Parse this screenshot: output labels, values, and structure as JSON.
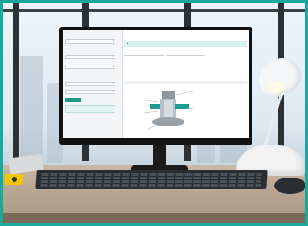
{
  "colors": {
    "accent": "#1a9d8f",
    "frame": "#19a89a",
    "notice_bg": "#d6f0ec"
  },
  "icons": [
    "caret-down-icon",
    "info-icon",
    "printer-icon"
  ]
}
